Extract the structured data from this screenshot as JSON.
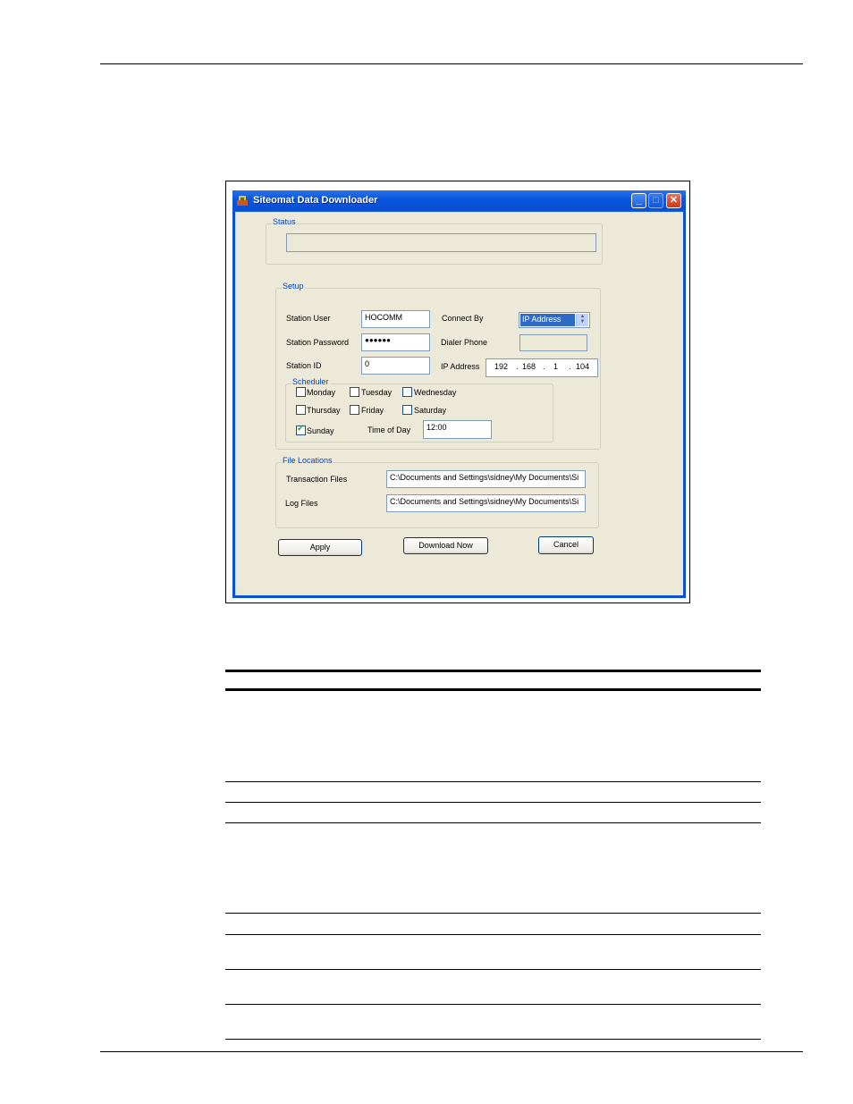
{
  "window": {
    "title": "Siteomat Data Downloader",
    "minimize": "_",
    "maximize": "□",
    "close": "✕"
  },
  "status": {
    "group_label": "Status",
    "value": ""
  },
  "setup": {
    "group_label": "Setup",
    "station_user_label": "Station User",
    "station_user_value": "HOCOMM",
    "station_password_label": "Station Password",
    "station_password_value": "●●●●●●",
    "station_id_label": "Station ID",
    "station_id_value": "0",
    "connect_by_label": "Connect By",
    "connect_by_value": "IP Address",
    "dialer_phone_label": "Dialer Phone",
    "dialer_phone_value": "",
    "ip_address_label": "IP Address",
    "ip": {
      "o1": "192",
      "o2": "168",
      "o3": "1",
      "o4": "104",
      "dot": "."
    }
  },
  "scheduler": {
    "group_label": "Scheduler",
    "days": {
      "monday": {
        "label": "Monday",
        "checked": false
      },
      "tuesday": {
        "label": "Tuesday",
        "checked": false
      },
      "wednesday": {
        "label": "Wednesday",
        "checked": false
      },
      "thursday": {
        "label": "Thursday",
        "checked": false
      },
      "friday": {
        "label": "Friday",
        "checked": false
      },
      "saturday": {
        "label": "Saturday",
        "checked": false
      },
      "sunday": {
        "label": "Sunday",
        "checked": true
      }
    },
    "time_of_day_label": "Time of Day",
    "time_of_day_value": "12:00"
  },
  "files": {
    "group_label": "File Locations",
    "transaction_label": "Transaction Files",
    "transaction_value": "C:\\Documents and Settings\\sidney\\My Documents\\Si",
    "log_label": "Log Files",
    "log_value": "C:\\Documents and Settings\\sidney\\My Documents\\Si"
  },
  "buttons": {
    "apply": "Apply",
    "download_now": "Download Now",
    "cancel": "Cancel"
  }
}
